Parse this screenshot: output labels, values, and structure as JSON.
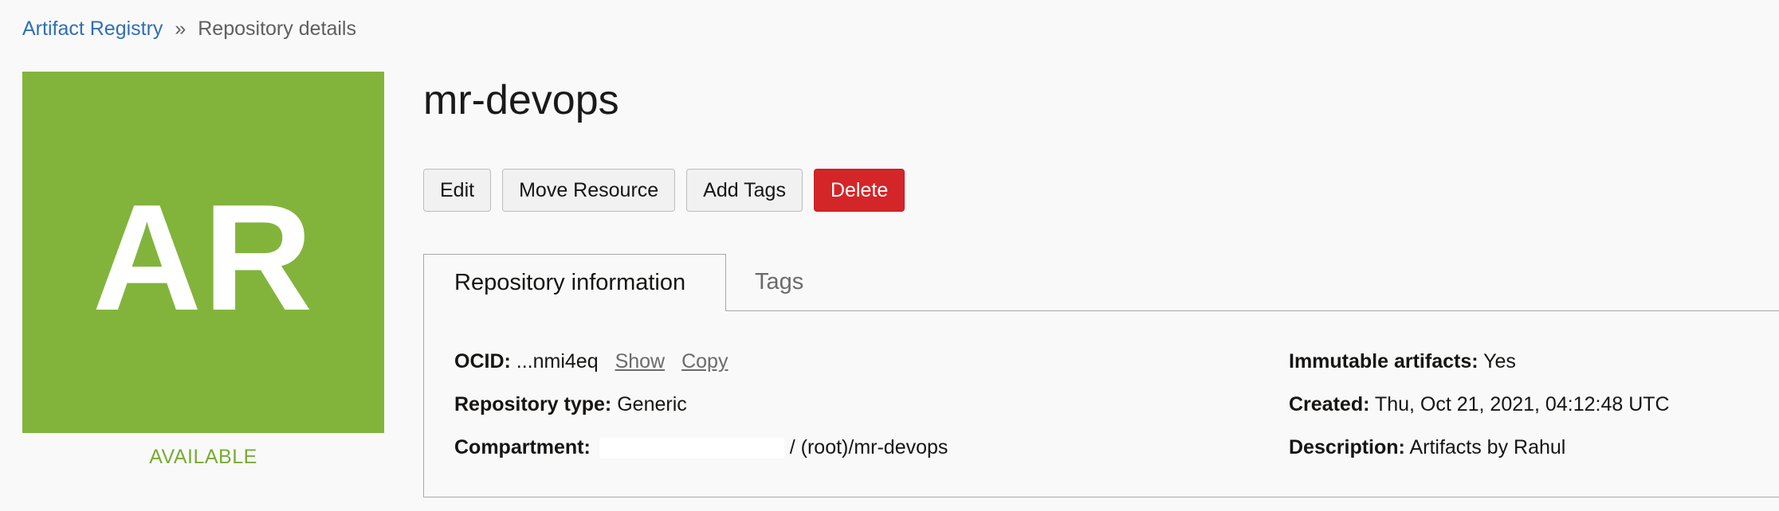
{
  "breadcrumb": {
    "root_label": "Artifact Registry",
    "separator": "»",
    "current_label": "Repository details"
  },
  "avatar": {
    "initials": "AR",
    "color": "#82b43c"
  },
  "status": {
    "label": "AVAILABLE",
    "color": "#7aaa36"
  },
  "page": {
    "title": "mr-devops"
  },
  "actions": {
    "edit_label": "Edit",
    "move_label": "Move Resource",
    "add_tags_label": "Add Tags",
    "delete_label": "Delete",
    "delete_color": "#d42528"
  },
  "tabs": [
    {
      "label": "Repository information",
      "active": true
    },
    {
      "label": "Tags",
      "active": false
    }
  ],
  "info": {
    "ocid": {
      "label": "OCID:",
      "value": "...nmi4eq",
      "show_label": "Show",
      "copy_label": "Copy"
    },
    "repository_type": {
      "label": "Repository type:",
      "value": "Generic"
    },
    "compartment": {
      "label": "Compartment:",
      "value": "/ (root)/mr-devops"
    },
    "immutable": {
      "label": "Immutable artifacts:",
      "value": "Yes"
    },
    "created": {
      "label": "Created:",
      "value": "Thu, Oct 21, 2021, 04:12:48 UTC"
    },
    "description": {
      "label": "Description:",
      "value": "Artifacts by Rahul"
    }
  }
}
